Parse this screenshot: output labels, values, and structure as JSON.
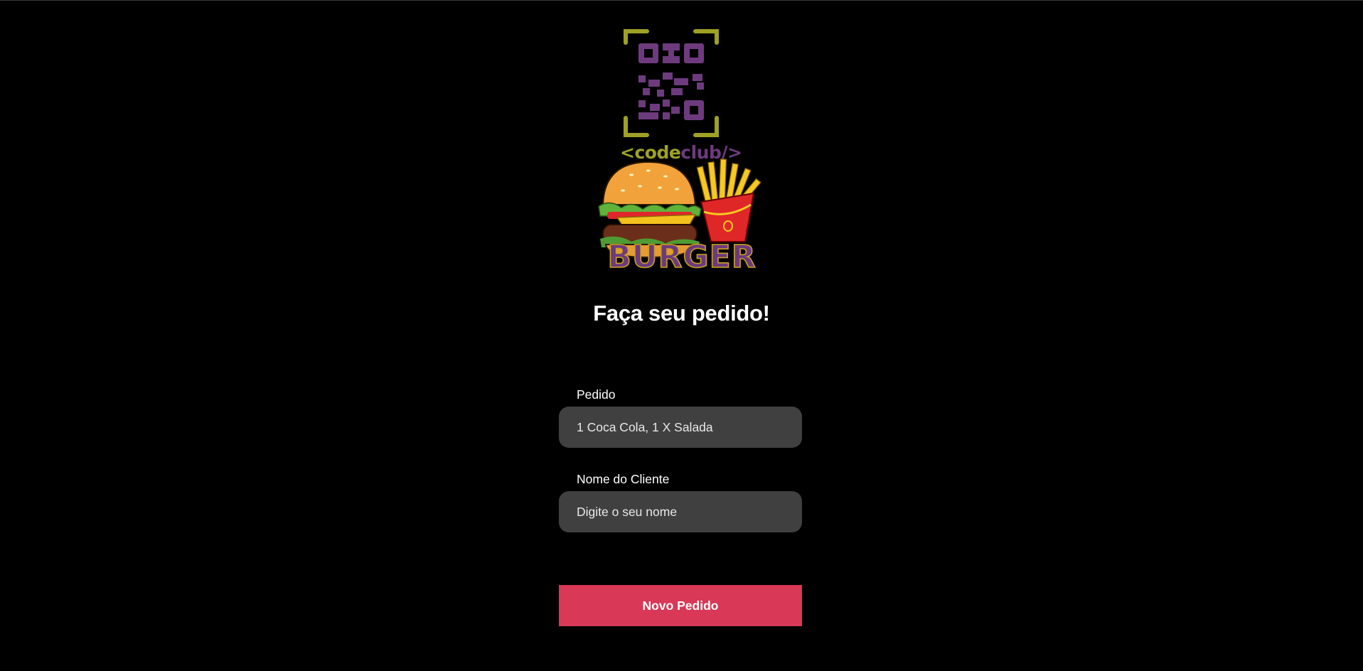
{
  "brand": {
    "logo_code": "<code",
    "logo_club": "club/>",
    "logo_burger": "BURGER"
  },
  "page": {
    "title": "Faça seu pedido!"
  },
  "form": {
    "order": {
      "label": "Pedido",
      "placeholder": "1 Coca Cola, 1 X Salada"
    },
    "customer": {
      "label": "Nome do Cliente",
      "placeholder": "Digite o seu nome"
    },
    "submit_label": "Novo Pedido"
  },
  "colors": {
    "background": "#000000",
    "input_bg": "#404040",
    "button": "#d93856",
    "logo_purple": "#6e3a7e",
    "logo_olive": "#a8b027"
  }
}
